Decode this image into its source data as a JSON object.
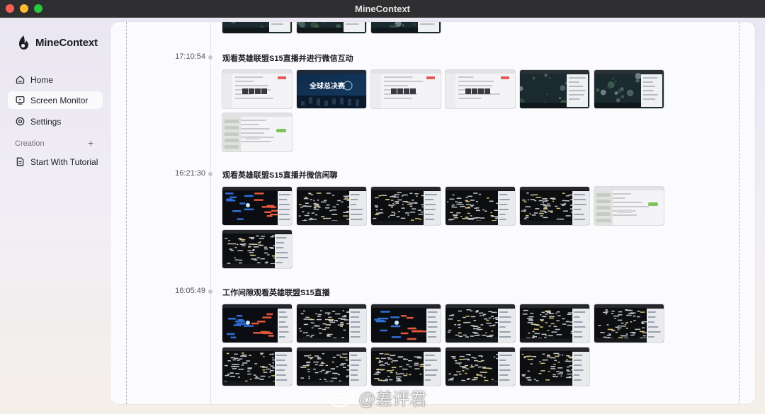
{
  "window": {
    "title": "MineContext"
  },
  "sidebar": {
    "brand": "MineContext",
    "nav": [
      {
        "label": "Home",
        "icon": "home-icon",
        "active": false
      },
      {
        "label": "Screen Monitor",
        "icon": "monitor-icon",
        "active": true
      },
      {
        "label": "Settings",
        "icon": "gear-icon",
        "active": false
      }
    ],
    "section": {
      "label": "Creation",
      "add": "+"
    },
    "creation_items": [
      {
        "label": "Start With Tutorial",
        "icon": "document-icon"
      }
    ]
  },
  "timeline": {
    "groups": [
      {
        "time": "17:10:54",
        "title": "观看英雄联盟S15直播并进行微信互动",
        "thumbs": [
          "light",
          "banner",
          "light",
          "light",
          "game",
          "game",
          "chat"
        ]
      },
      {
        "time": "16:21:30",
        "title": "观看英雄联盟S15直播并微信闲聊",
        "thumbs": [
          "map",
          "dark",
          "dark",
          "dark",
          "dark",
          "chat",
          "dark"
        ]
      },
      {
        "time": "16:05:49",
        "title": "工作间隙观看英雄联盟S15直播",
        "thumbs": [
          "map",
          "dark",
          "map",
          "dark",
          "dark",
          "dark",
          "dark",
          "dark",
          "dark",
          "dark",
          "dark"
        ]
      }
    ],
    "top_partial_thumbs": [
      "game",
      "game",
      "game"
    ],
    "banner_text": "全球总决赛"
  },
  "watermark": {
    "text": "@差评君"
  },
  "colors": {
    "titlebar": "#2f2f31",
    "close": "#fe5f57",
    "minimize": "#febc2e",
    "maximize": "#28c840"
  }
}
